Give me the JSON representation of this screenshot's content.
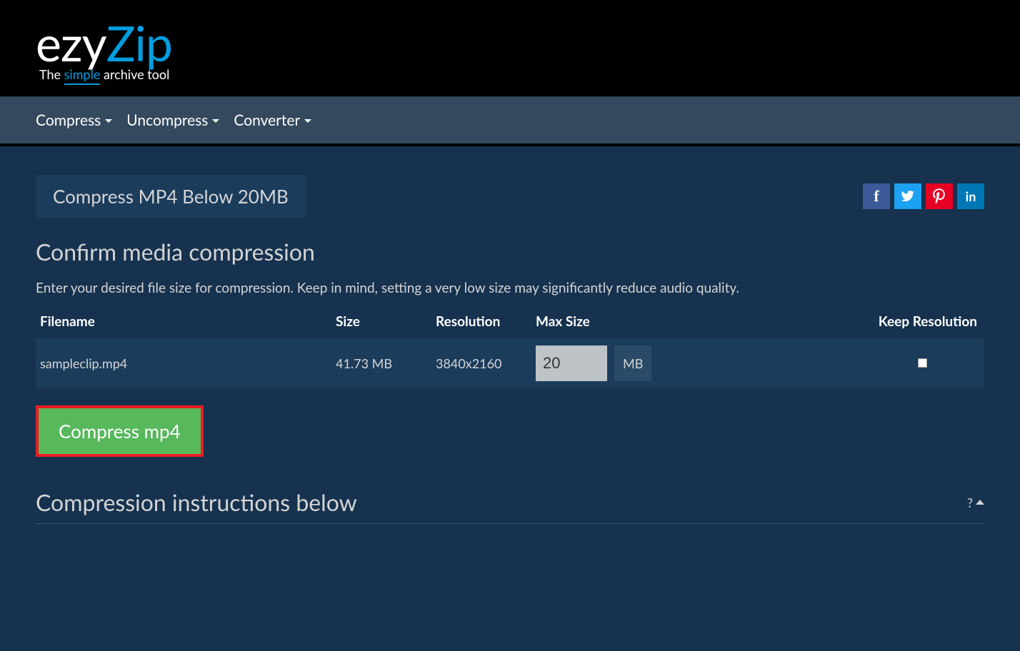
{
  "logo": {
    "part1": "ezy",
    "part2": "Zip",
    "tagline_pre": "The ",
    "tagline_simple": "simple",
    "tagline_post": " archive tool"
  },
  "nav": {
    "compress": "Compress",
    "uncompress": "Uncompress",
    "converter": "Converter"
  },
  "tab": {
    "title": "Compress MP4 Below 20MB"
  },
  "social": {
    "facebook": "f",
    "twitter": "",
    "pinterest": "",
    "linkedin": "in"
  },
  "form": {
    "title": "Confirm media compression",
    "description": "Enter your desired file size for compression. Keep in mind, setting a very low size may significantly reduce audio quality.",
    "headers": {
      "filename": "Filename",
      "size": "Size",
      "resolution": "Resolution",
      "maxsize": "Max Size",
      "keepres": "Keep Resolution"
    },
    "row": {
      "filename": "sampleclip.mp4",
      "size": "41.73 MB",
      "resolution": "3840x2160",
      "maxsize_value": "20",
      "maxsize_unit": "MB"
    },
    "compress_button": "Compress mp4"
  },
  "instructions": {
    "title": "Compression instructions below",
    "help": "?"
  }
}
